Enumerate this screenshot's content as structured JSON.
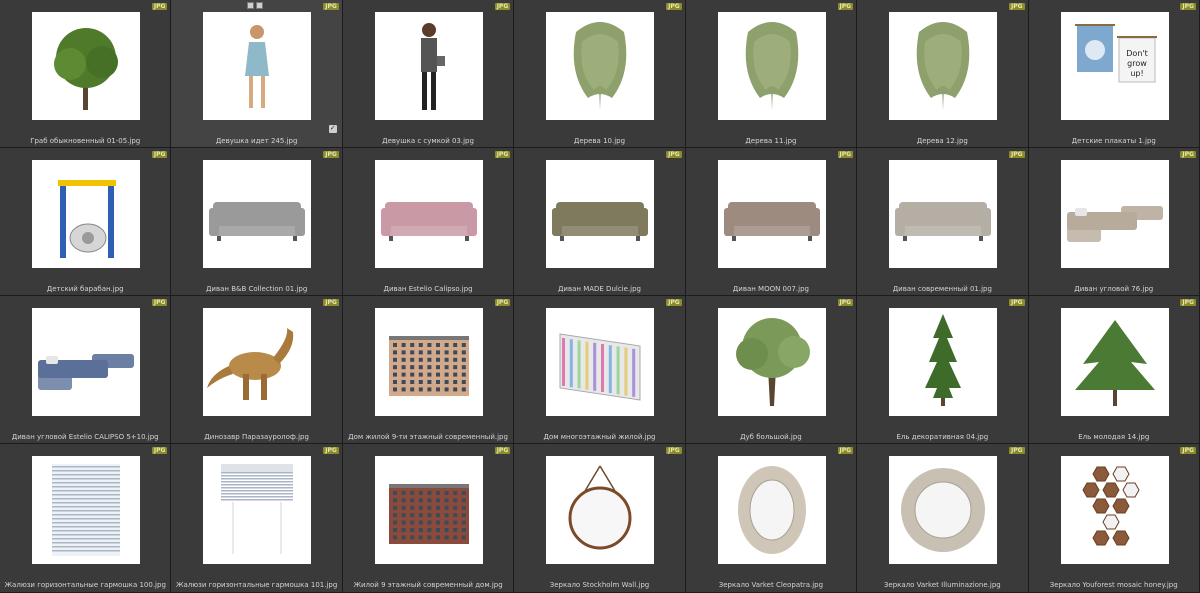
{
  "badge_text": "JPG",
  "check_glyph": "✓",
  "items": [
    {
      "label": "Граб обыкновенный 01-05.jpg",
      "icon": "tree-icon",
      "kind": "tree"
    },
    {
      "label": "Девушка идет 245.jpg",
      "icon": "woman-walking-icon",
      "kind": "woman",
      "selected": true
    },
    {
      "label": "Девушка с сумкой 03.jpg",
      "icon": "woman-with-bag-icon",
      "kind": "woman2"
    },
    {
      "label": "Дерева 10.jpg",
      "icon": "birch-tree-icon",
      "kind": "birch"
    },
    {
      "label": "Дерева 11.jpg",
      "icon": "birch-tree-icon",
      "kind": "birch"
    },
    {
      "label": "Дерева 12.jpg",
      "icon": "birch-tree-icon",
      "kind": "birch"
    },
    {
      "label": "Детские плакаты 1.jpg",
      "icon": "posters-icon",
      "kind": "posters"
    },
    {
      "label": "Детский барабан.jpg",
      "icon": "playground-drum-icon",
      "kind": "drum"
    },
    {
      "label": "Диван B&B Collection 01.jpg",
      "icon": "sofa-icon",
      "kind": "sofa",
      "color": "#9a9a9a"
    },
    {
      "label": "Диван Estelio Calipso.jpg",
      "icon": "sofa-icon",
      "kind": "sofa",
      "color": "#c99aa6"
    },
    {
      "label": "Диван MADE Dulcie.jpg",
      "icon": "sofa-icon",
      "kind": "sofa",
      "color": "#7f7a5e"
    },
    {
      "label": "Диван MOON 007.jpg",
      "icon": "sofa-icon",
      "kind": "sofa",
      "color": "#9d8b80"
    },
    {
      "label": "Диван современный 01.jpg",
      "icon": "sofa-icon",
      "kind": "sofa",
      "color": "#b4aea4"
    },
    {
      "label": "Диван угловой 76.jpg",
      "icon": "corner-sofa-icon",
      "kind": "corner",
      "color": "#b7ab9b"
    },
    {
      "label": "Диван угловой Estelio CALIPSO 5+10.jpg",
      "icon": "corner-sofa-icon",
      "kind": "corner",
      "color": "#5b7099"
    },
    {
      "label": "Динозавр Паразауролоф.jpg",
      "icon": "dinosaur-icon",
      "kind": "dino"
    },
    {
      "label": "Дом жилой 9-ти этажный современный.jpg",
      "icon": "building-icon",
      "kind": "building",
      "color": "#d2a98a"
    },
    {
      "label": "Дом многоэтажный жилой.jpg",
      "icon": "building-icon",
      "kind": "tower"
    },
    {
      "label": "Дуб большой.jpg",
      "icon": "oak-tree-icon",
      "kind": "oak"
    },
    {
      "label": "Ель декоративная 04.jpg",
      "icon": "spruce-icon",
      "kind": "spruce"
    },
    {
      "label": "Ель молодая 14.jpg",
      "icon": "spruce-icon",
      "kind": "pine"
    },
    {
      "label": "Жалюзи горизонтальные гармошка 100.jpg",
      "icon": "blinds-icon",
      "kind": "blinds"
    },
    {
      "label": "Жалюзи горизонтальные гармошка 101.jpg",
      "icon": "blinds-icon",
      "kind": "blinds2"
    },
    {
      "label": "Жилой 9 этажный современный дом.jpg",
      "icon": "building-icon",
      "kind": "building",
      "color": "#8a4a3c"
    },
    {
      "label": "Зеркало Stockholm Wall.jpg",
      "icon": "round-mirror-icon",
      "kind": "mirror"
    },
    {
      "label": "Зеркало Varket Cleopatra.jpg",
      "icon": "ornate-mirror-icon",
      "kind": "ornate"
    },
    {
      "label": "Зеркало Varket Illuminazione.jpg",
      "icon": "ornate-mirror-icon",
      "kind": "ornate2"
    },
    {
      "label": "Зеркало Youforest mosaic honey.jpg",
      "icon": "mosaic-mirror-icon",
      "kind": "mosaic"
    }
  ]
}
